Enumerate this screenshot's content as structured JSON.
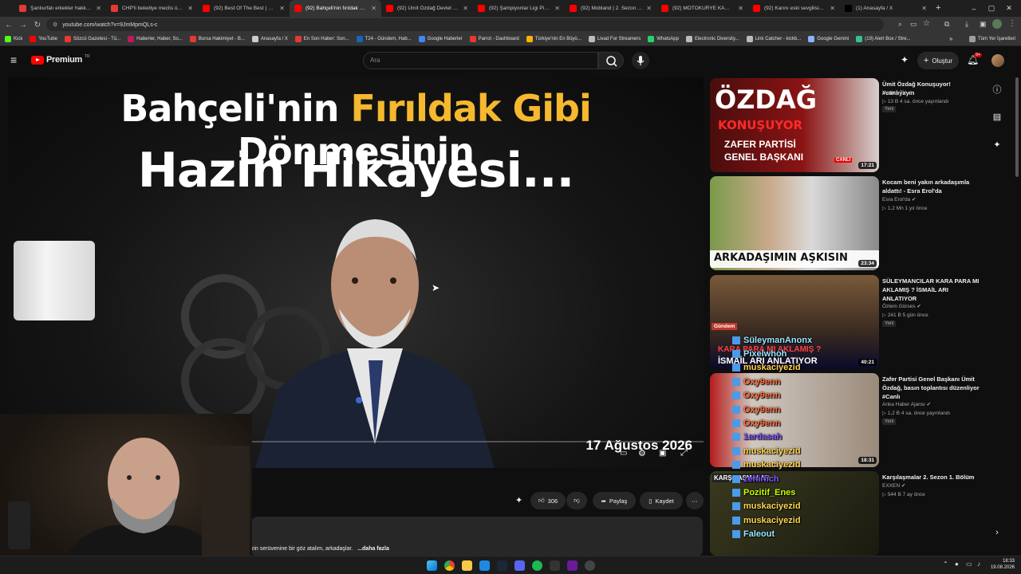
{
  "browser": {
    "tabs": [
      {
        "title": "Şanlıurfalı erkekler hakkında v",
        "favicon_color": "#e53935"
      },
      {
        "title": "CHP'li belediye meclis üyesi g",
        "favicon_color": "#e53935"
      },
      {
        "title": "(92) Best Of The Best | Official",
        "favicon_color": "#ff0000"
      },
      {
        "title": "(92) Bahçeli'nin fırıldak gibi dö",
        "favicon_color": "#ff0000"
      },
      {
        "title": "(92) Ümit Özdağ Devlet Bahçe",
        "favicon_color": "#ff0000"
      },
      {
        "title": "(92) Şampiyonlar Ligi Play Off",
        "favicon_color": "#ff0000"
      },
      {
        "title": "(92) Mobland | 2. Sezon Altya",
        "favicon_color": "#ff0000"
      },
      {
        "title": "(92) MOTOKURYE KAMERASI",
        "favicon_color": "#ff0000"
      },
      {
        "title": "(92) Karını eski sevgilisine kar",
        "favicon_color": "#ff0000"
      },
      {
        "title": "(1) Anasayfa / X",
        "favicon_color": "#000000"
      }
    ],
    "active_tab_index": 3,
    "url": "youtube.com/watch?v=9JmMpmQLs-c",
    "bookmarks": [
      {
        "label": "Kick",
        "color": "#53fc18"
      },
      {
        "label": "YouTube",
        "color": "#ff0000"
      },
      {
        "label": "Sözcü Gazetesi - Tü...",
        "color": "#e53935"
      },
      {
        "label": "Haberler, Haber, So...",
        "color": "#c2185b"
      },
      {
        "label": "Bursa Hakimiyet - B...",
        "color": "#e53935"
      },
      {
        "label": "Anasayfa / X",
        "color": "#cccccc"
      },
      {
        "label": "En Son Haber: Son...",
        "color": "#e53935"
      },
      {
        "label": "T24 - Gündem, Hab...",
        "color": "#1565c0"
      },
      {
        "label": "Google Haberler",
        "color": "#4285f4"
      },
      {
        "label": "Parrot - Dashboard",
        "color": "#e53935"
      },
      {
        "label": "Türkiye'nin En Büyü...",
        "color": "#ffb300"
      },
      {
        "label": "Livad For Streamers",
        "color": "#bbbbbb"
      },
      {
        "label": "WhatsApp",
        "color": "#25d366"
      },
      {
        "label": "Electronic Diversity...",
        "color": "#bbbbbb"
      },
      {
        "label": "Link Catcher - kickb...",
        "color": "#bbbbbb"
      },
      {
        "label": "Google Gemini",
        "color": "#8ab4f8"
      },
      {
        "label": "(19) Alert Box / Stre...",
        "color": "#31c48d"
      }
    ],
    "all_bookmarks_label": "Tüm Yer İşaretleri"
  },
  "youtube": {
    "logo_text": "Premium",
    "logo_superscript": "TR",
    "search_placeholder": "Ara",
    "create_label": "Oluştur",
    "notification_count": "9+"
  },
  "video": {
    "thumb_title_line1_white_a": "Bahçeli'nin ",
    "thumb_title_line1_gold": "Fırıldak Gibi",
    "thumb_title_line1_white_b": " Dönmesinin",
    "thumb_title_line2": "Hazin Hikayesi...",
    "thumb_date": "17 Ağustos 2026",
    "likes": "306",
    "share_label": "Paylaş",
    "save_label": "Kaydet",
    "description_snippet": "zin serüvenine bir göz atalım, arkadaşlar.",
    "more_label": "...daha fazla"
  },
  "recommendations": [
    {
      "title": "Ümit Özdağ Konuşuyor! #canlıyayın",
      "channel": "Yurttaş TV",
      "meta": "13 B  4 sa. önce yayınlandı",
      "badge": "Yeni",
      "duration": "17:21",
      "thumb_text_1": "ÖZDAĞ",
      "thumb_text_2": "KONUŞUYOR",
      "thumb_text_3": "ZAFER PARTİSİ",
      "thumb_text_4": "GENEL BAŞKANI",
      "thumb_text_5": "CANLI"
    },
    {
      "title": "Kocam beni yakın arkadaşımla aldattı! - Esra Erol'da",
      "channel": "Esra Erol'da",
      "meta": "1,2 Mn  1 yıl önce",
      "badge": "",
      "duration": "23:34",
      "thumb_text_1": "ARKADAŞIMIN AŞKISIN"
    },
    {
      "title": "SÜLEYMANCILAR KARA PARA MI AKLAMIŞ ? İSMAİL ARI ANLATIYOR",
      "channel": "Özlem Gürses",
      "meta": "241 B  5 gün önce",
      "badge": "Yeni",
      "duration": "40:21",
      "thumb_text_1": "Gündem",
      "thumb_text_2": "KARA PARA MI AKLAMIŞ ?",
      "thumb_text_3": "İSMAİL ARI ANLATIYOR"
    },
    {
      "title": "Zafer Partisi Genel Başkanı Ümit Özdağ, basın toplantısı düzenliyor #Canlı",
      "channel": "Anka Haber Ajansı",
      "meta": "1,2 B  4 sa. önce yayınlandı",
      "badge": "Yeni",
      "duration": "18:31"
    },
    {
      "title": "Karşılaşmalar 2. Sezon 1. Bölüm",
      "channel": "EXXEN",
      "meta": "544 B  7 ay önce",
      "badge": "",
      "duration": "",
      "thumb_text_1": "KARŞILAŞMALAR"
    }
  ],
  "chat_overlay": [
    {
      "user": "SüleymanAnonx",
      "color": "#9be8ff"
    },
    {
      "user": "Pixelwhoh",
      "color": "#9be8ff"
    },
    {
      "user": "muskaciyezid",
      "color": "#ffd54f"
    },
    {
      "user": "Oxy9enn",
      "color": "#ff7043"
    },
    {
      "user": "Oxy9enn",
      "color": "#ff7043"
    },
    {
      "user": "Oxy9enn",
      "color": "#ff7043"
    },
    {
      "user": "Oxy9enn",
      "color": "#ff7043"
    },
    {
      "user": "1ardasah",
      "color": "#7e57ff"
    },
    {
      "user": "muskaciyezid",
      "color": "#ffd54f"
    },
    {
      "user": "muskaciyezid",
      "color": "#ffd54f"
    },
    {
      "user": "zehirlich",
      "color": "#7e57ff"
    },
    {
      "user": "Pozitif_Enes",
      "color": "#c6ff00"
    },
    {
      "user": "muskaciyezid",
      "color": "#ffd54f"
    },
    {
      "user": "muskaciyezid",
      "color": "#ffd54f"
    },
    {
      "user": "Faleout",
      "color": "#9be8ff"
    }
  ],
  "taskbar": {
    "time": "18:33",
    "date": "19.08.2026"
  }
}
